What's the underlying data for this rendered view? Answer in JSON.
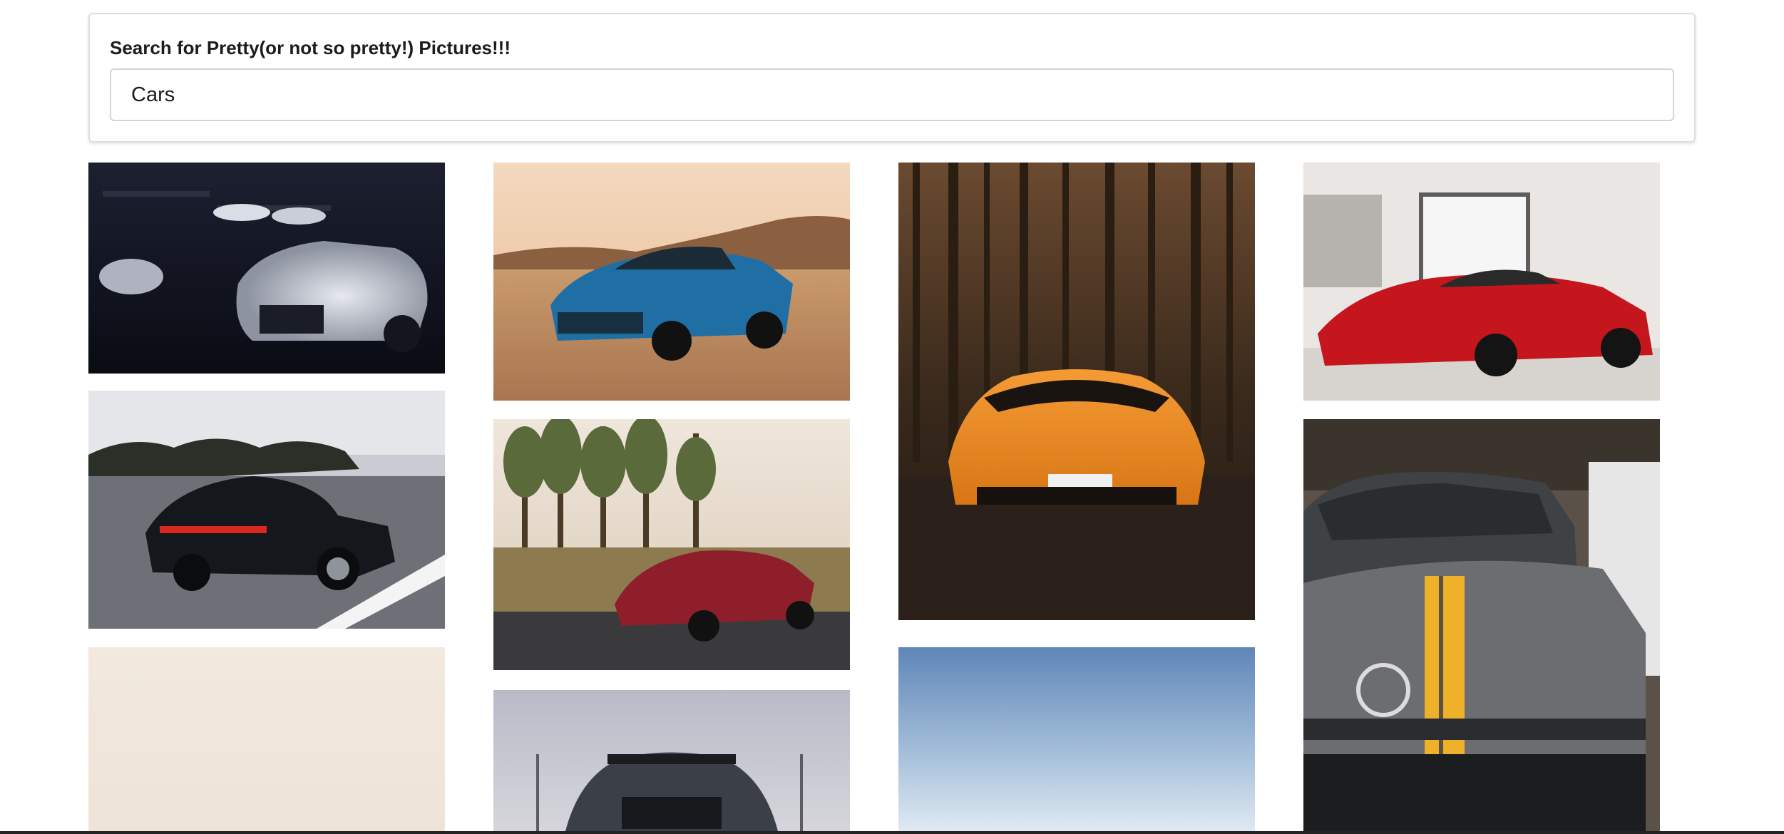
{
  "search": {
    "label": "Search for Pretty(or not so pretty!) Pictures!!!",
    "value": "Cars"
  },
  "results": {
    "query": "Cars",
    "photos": [
      {
        "subject": "white-camaro-in-dark-garage-photo"
      },
      {
        "subject": "blue-camaro-in-desert-photo"
      },
      {
        "subject": "orange-lamborghini-in-forest-photo"
      },
      {
        "subject": "red-ferrari-in-showroom-photo"
      },
      {
        "subject": "black-porsche-on-highway-photo"
      },
      {
        "subject": "red-mercedes-amg-gt-by-forest-photo"
      },
      {
        "subject": "grey-mercedes-amg-yellow-stripe-photo"
      },
      {
        "subject": "beige-minimal-photo"
      },
      {
        "subject": "grey-mustang-steeda-photo"
      },
      {
        "subject": "blue-sky-photo"
      }
    ]
  }
}
